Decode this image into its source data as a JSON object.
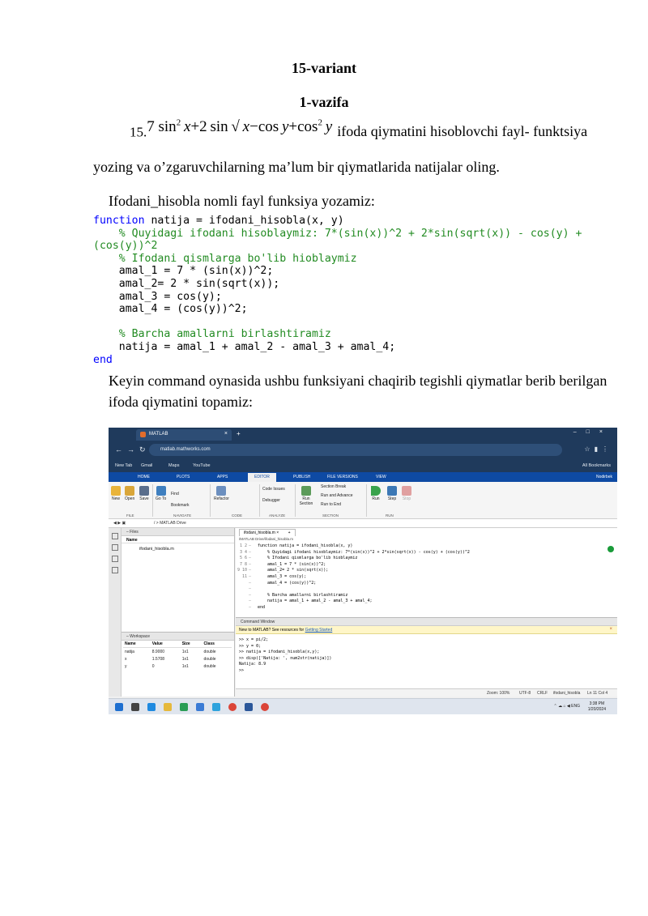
{
  "doc": {
    "title": "15-variant",
    "subtitle": "1-vazifa",
    "formula_number": "15.",
    "formula_rest": "ifoda qiymatini hisoblovchi fayl- funktsiya",
    "para2": "yozing va o’zgaruvchilarning ma’lum bir qiymatlarida natijalar oling.",
    "para3": "Ifodani_hisobla nomli fayl funksiya yozamiz:",
    "para4": "Keyin command oynasida ushbu funksiyani chaqirib tegishli qiymatlar berib berilgan ifoda qiymatini topamiz:"
  },
  "code": {
    "kw_function": "function",
    "line1": " natija = ifodani_hisobla(x, y)",
    "comment1": "    % Quyidagi ifodani hisoblaymiz: 7*(sin(x))^2 + 2*sin(sqrt(x)) - cos(y) +\n(cos(y))^2",
    "comment2": "    % Ifodani qismlarga bo'lib hioblaymiz",
    "body1": "    amal_1 = 7 * (sin(x))^2;\n    amal_2= 2 * sin(sqrt(x));\n    amal_3 = cos(y);\n    amal_4 = (cos(y))^2;\n",
    "comment3": "    % Barcha amallarni birlashtiramiz",
    "body2": "    natija = amal_1 + amal_2 - amal_3 + amal_4;",
    "kw_end": "end"
  },
  "browser": {
    "tab_title": "MATLAB",
    "url": "matlab.mathworks.com",
    "bookmarks": [
      "New Tab",
      "Gmail",
      "Maps",
      "YouTube"
    ],
    "all_bookmarks": "All Bookmarks"
  },
  "matlab": {
    "tabs": [
      "HOME",
      "PLOTS",
      "APPS",
      "EDITOR",
      "PUBLISH",
      "FILE VERSIONS",
      "VIEW"
    ],
    "user": "Nodirbek",
    "ribbon": {
      "new": "New",
      "open": "Open",
      "save": "Save",
      "goto": "Go To",
      "find": "Find",
      "bookmark": "Bookmark",
      "refactor": "Refactor",
      "code_issues": "Code Issues",
      "debugger": "Debugger",
      "run_section": "Run Section",
      "section_break": "Section Break",
      "run_and_advance": "Run and Advance",
      "run_to_end": "Run to End",
      "run": "Run",
      "step": "Step",
      "stop": "Stop",
      "groups": [
        "FILE",
        "NAVIGATE",
        "CODE",
        "ANALYZE",
        "SECTION",
        "RUN"
      ]
    },
    "path": "/  >  MATLAB Drive",
    "files_title": "Files",
    "files_col": "Name",
    "file_item": "ifodani_hisobla.m",
    "workspace_title": "Workspace",
    "ws_headers": [
      "Name",
      "Value",
      "Size",
      "Class"
    ],
    "ws_rows": [
      [
        "natija",
        "8.9000",
        "1x1",
        "double"
      ],
      [
        "x",
        "1.5708",
        "1x1",
        "double"
      ],
      [
        "y",
        "0",
        "1x1",
        "double"
      ]
    ],
    "editor_tab": "ifodani_hisobla.m",
    "editor_path": "/MATLAB Drive/ifodani_hisobla.m",
    "line_numbers": "1\n2\n3\n4\n5\n6\n7\n8\n9\n10\n11",
    "editor_src": "function natija = ifodani_hisobla(x, y)\n    % Quyidagi ifodani hisoblaymiz: 7*(sin(x))^2 + 2*sin(sqrt(x)) - cos(y) + (cos(y))^2\n    % Ifodani qismlarga bo'lib hioblaymiz\n    amal_1 = 7 * (sin(x))^2;\n    amal_2= 2 * sin(sqrt(x));\n    amal_3 = cos(y);\n    amal_4 = (cos(y))^2;\n\n    % Barcha amallarni birlashtiramiz\n    natija = amal_1 + amal_2 - amal_3 + amal_4;\nend",
    "cmd_title": "Command Window",
    "banner_text": "New to MATLAB? See resources for ",
    "banner_link": "Getting Started",
    "cmd_output": ">> x = pi/2;\n>> y = 0;\n>> natija = ifodani_hisobla(x,y);\n>> disp(['Natija: ', num2str(natija)])\nNatija: 8.9\n>>",
    "status": {
      "zoom": "Zoom: 100%",
      "enc": "UTF-8",
      "eol": "CRLF",
      "file": "ifodani_hisobla",
      "pos": "Ln 11  Col 4"
    }
  },
  "taskbar": {
    "time": "3:38 PM",
    "date": "1/20/2024",
    "lang": "ENG"
  }
}
